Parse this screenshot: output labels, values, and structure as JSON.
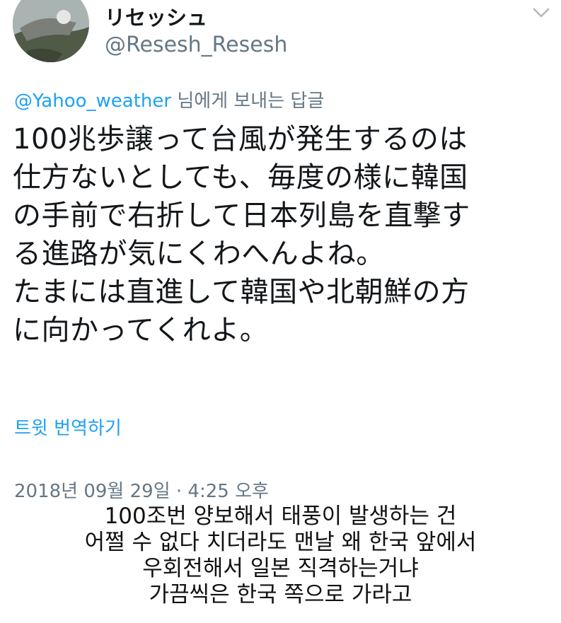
{
  "tweet": {
    "display_name": "リセッシュ",
    "username": "@Resesh_Resesh",
    "more_icon": "chevron-down-icon",
    "reply_to_handle": "@Yahoo_weather",
    "reply_to_suffix": " 님에게 보내는 답글",
    "body_lines": [
      "100兆歩譲って台風が発生するのは",
      "仕方ないとしても、毎度の様に韓国",
      "の手前で右折して日本列島を直撃す",
      "る進路が気にくわへんよね。",
      "たまには直進して韓国や北朝鮮の方",
      "に向かってくれよ。"
    ],
    "translate_label": "트윗 번역하기",
    "timestamp": "2018년 09월 29일 · 4:25 오후"
  },
  "caption": {
    "lines": [
      "100조번 양보해서 태풍이 발생하는 건",
      "어쩔 수 없다 치더라도 맨날 왜 한국 앞에서",
      "우회전해서 일본 직격하는거냐",
      "가끔씩은 한국 쪽으로 가라고"
    ]
  }
}
